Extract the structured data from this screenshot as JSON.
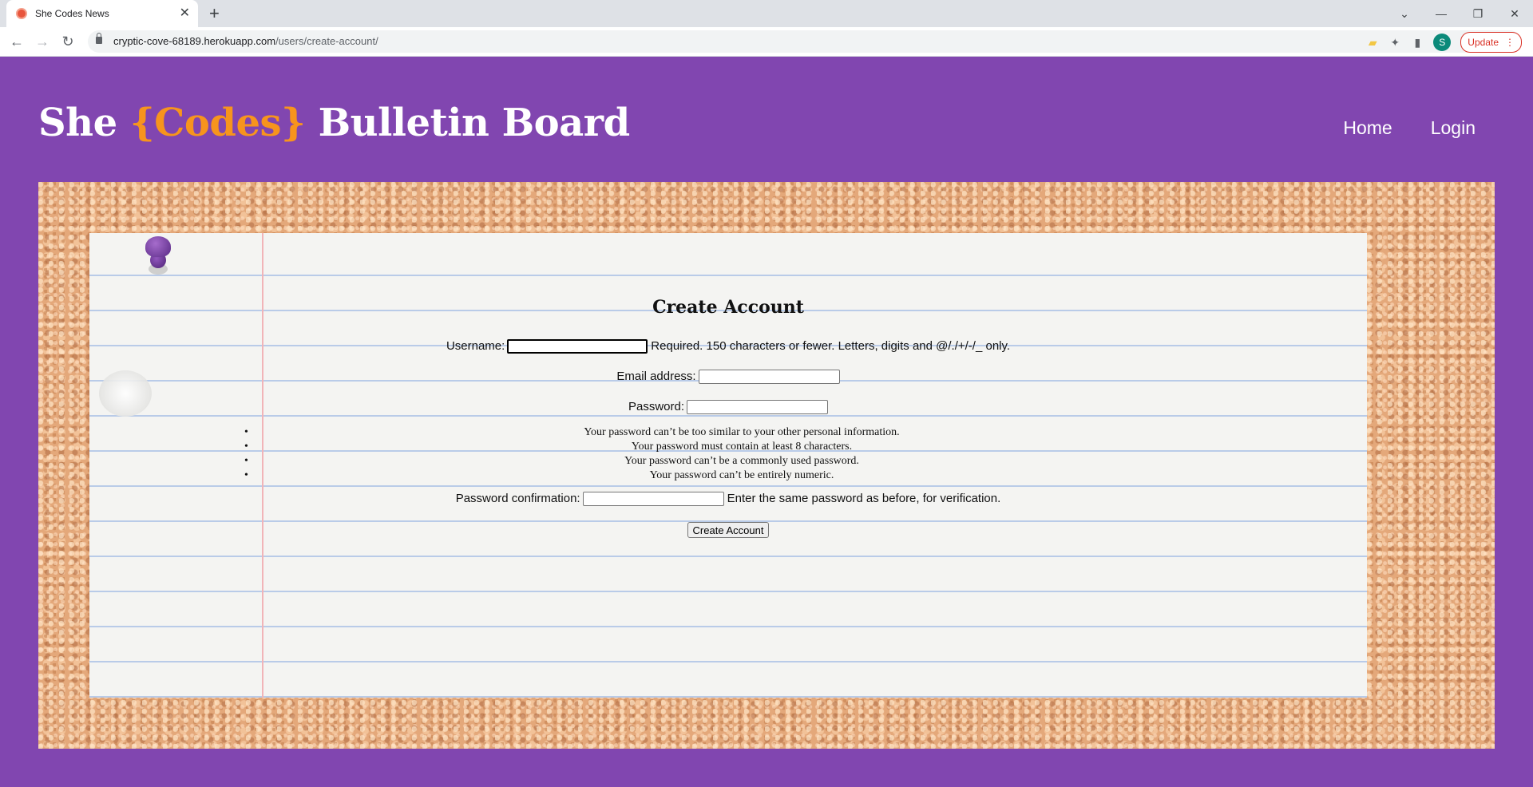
{
  "browser": {
    "tab_title": "She Codes News",
    "url_host": "cryptic-cove-68189.herokuapp.com",
    "url_path": "/users/create-account/",
    "profile_initial": "S",
    "update_label": "Update"
  },
  "site": {
    "title_prefix": "She ",
    "title_codes": "{Codes}",
    "title_suffix": " Bulletin Board",
    "nav": {
      "home": "Home",
      "login": "Login"
    }
  },
  "form": {
    "title": "Create Account",
    "username_label": "Username:",
    "username_value": "",
    "username_help": "Required. 150 characters or fewer. Letters, digits and @/./+/-/_ only.",
    "email_label": "Email address:",
    "email_value": "",
    "password_label": "Password:",
    "password_value": "",
    "password_rules": [
      "Your password can’t be too similar to your other personal information.",
      "Your password must contain at least 8 characters.",
      "Your password can’t be a commonly used password.",
      "Your password can’t be entirely numeric."
    ],
    "password_confirm_label": "Password confirmation:",
    "password_confirm_value": "",
    "password_confirm_help": "Enter the same password as before, for verification.",
    "submit_label": "Create Account"
  },
  "colors": {
    "page_background": "#8146b0",
    "title_accent": "#f7941d",
    "cork": "#e4a87a",
    "paper": "#f4f4f2"
  }
}
